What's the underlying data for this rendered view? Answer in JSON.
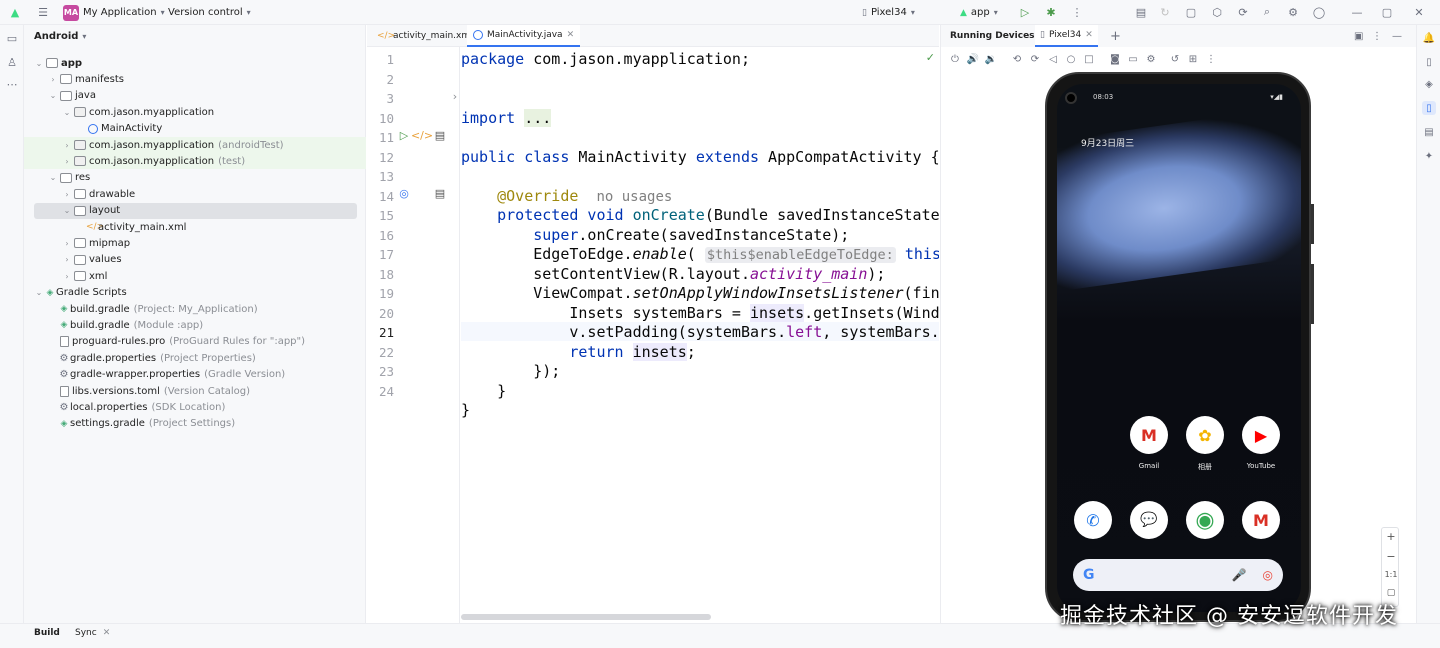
{
  "titlebar": {
    "project_badge": "MA",
    "project_name": "My Application",
    "vcs": "Version control",
    "device": "Pixel34",
    "run_config": "app"
  },
  "project": {
    "view_mode": "Android",
    "tree": [
      {
        "label": "app",
        "hint": "",
        "icon": "folder",
        "level": 0,
        "bold": true
      },
      {
        "label": "manifests",
        "hint": "",
        "icon": "folder",
        "level": 1
      },
      {
        "label": "java",
        "hint": "",
        "icon": "folder",
        "level": 1
      },
      {
        "label": "com.jason.myapplication",
        "hint": "",
        "icon": "package",
        "level": 2
      },
      {
        "label": "MainActivity",
        "hint": "",
        "icon": "class",
        "level": 3
      },
      {
        "label": "com.jason.myapplication",
        "hint": "(androidTest)",
        "icon": "package",
        "level": 2,
        "test": true
      },
      {
        "label": "com.jason.myapplication",
        "hint": "(test)",
        "icon": "package",
        "level": 2,
        "test": true
      },
      {
        "label": "res",
        "hint": "",
        "icon": "folder",
        "level": 1
      },
      {
        "label": "drawable",
        "hint": "",
        "icon": "folder",
        "level": 2
      },
      {
        "label": "layout",
        "hint": "",
        "icon": "folder",
        "level": 2,
        "selected": true
      },
      {
        "label": "activity_main.xml",
        "hint": "",
        "icon": "xml",
        "level": 3
      },
      {
        "label": "mipmap",
        "hint": "",
        "icon": "folder",
        "level": 2
      },
      {
        "label": "values",
        "hint": "",
        "icon": "folder",
        "level": 2
      },
      {
        "label": "xml",
        "hint": "",
        "icon": "folder",
        "level": 2
      },
      {
        "label": "Gradle Scripts",
        "hint": "",
        "icon": "gradle",
        "level": 0
      },
      {
        "label": "build.gradle",
        "hint": "(Project: My_Application)",
        "icon": "gradle",
        "level": 1
      },
      {
        "label": "build.gradle",
        "hint": "(Module :app)",
        "icon": "gradle",
        "level": 1
      },
      {
        "label": "proguard-rules.pro",
        "hint": "(ProGuard Rules for \":app\")",
        "icon": "doc",
        "level": 1
      },
      {
        "label": "gradle.properties",
        "hint": "(Project Properties)",
        "icon": "gear",
        "level": 1
      },
      {
        "label": "gradle-wrapper.properties",
        "hint": "(Gradle Version)",
        "icon": "gear",
        "level": 1
      },
      {
        "label": "libs.versions.toml",
        "hint": "(Version Catalog)",
        "icon": "doc",
        "level": 1
      },
      {
        "label": "local.properties",
        "hint": "(SDK Location)",
        "icon": "gear",
        "level": 1
      },
      {
        "label": "settings.gradle",
        "hint": "(Project Settings)",
        "icon": "gradle",
        "level": 1
      }
    ]
  },
  "editor": {
    "tabs": [
      {
        "label": "activity_main.xml",
        "active": false
      },
      {
        "label": "MainActivity.java",
        "active": true
      }
    ],
    "line_numbers": [
      "1",
      "2",
      "3",
      "10",
      "11",
      "12",
      "13",
      "14",
      "15",
      "16",
      "17",
      "18",
      "19",
      "20",
      "21",
      "22",
      "23",
      "24"
    ],
    "current_line": "21"
  },
  "devices": {
    "panel_title": "Running Devices",
    "device_tab": "Pixel34",
    "status_time": "08:03",
    "date_text": "9月23日周三",
    "apps_row1": [
      {
        "label": "Gmail",
        "glyph": "M",
        "color": "#d93025"
      },
      {
        "label": "相册",
        "glyph": "✿",
        "color": "#f4b400"
      },
      {
        "label": "YouTube",
        "glyph": "▶",
        "color": "#ff0000"
      }
    ],
    "apps_row2": [
      {
        "glyph": "✆",
        "color": "#1a73e8"
      },
      {
        "glyph": "💬",
        "color": "#1a73e8"
      },
      {
        "glyph": "◉",
        "color": "#34a853"
      },
      {
        "glyph": "M",
        "color": "#d93025"
      }
    ],
    "search_logo": "G",
    "zoom_in": "+",
    "zoom_out": "−",
    "zoom_ratio": "1:1"
  },
  "bottom": {
    "build_label": "Build",
    "sync_label": "Sync"
  },
  "watermark": "掘金技术社区 @ 安安逗软件开发"
}
